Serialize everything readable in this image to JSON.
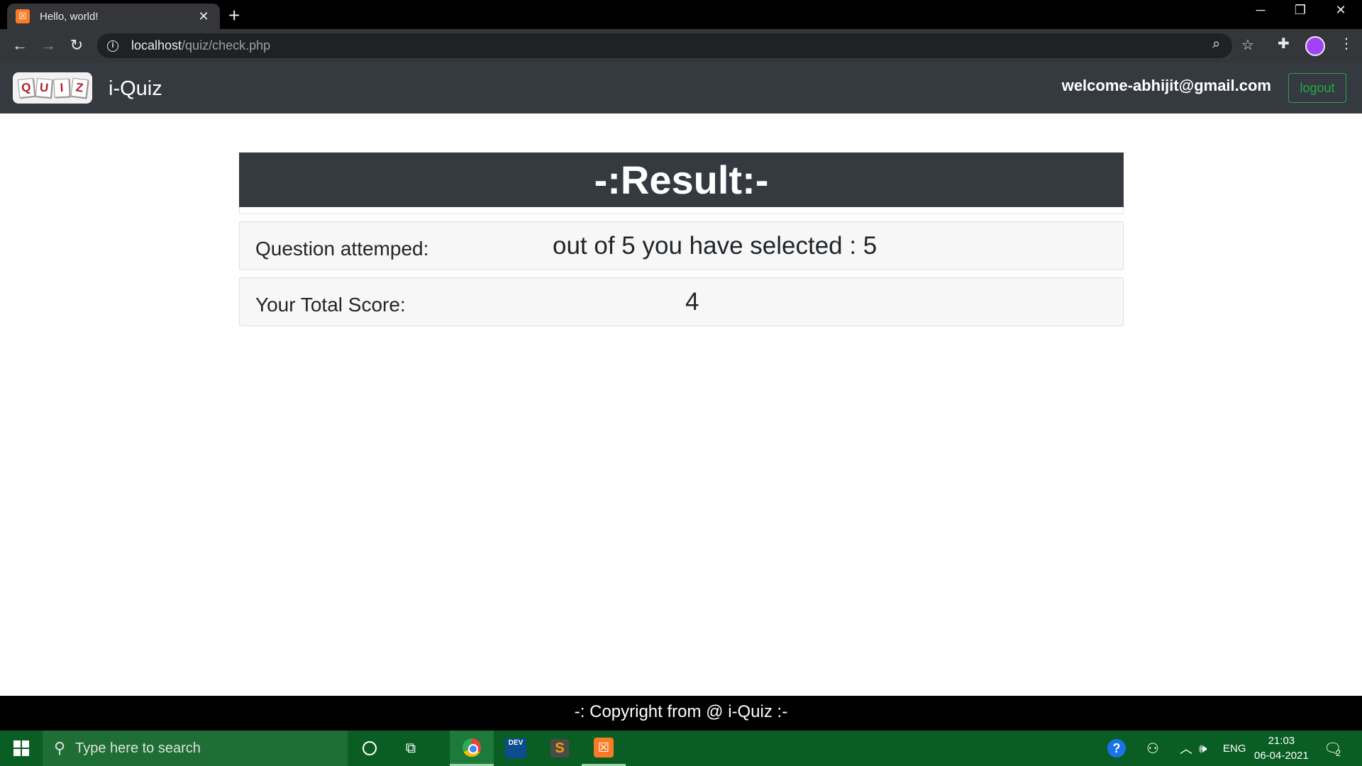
{
  "browser": {
    "tab_title": "Hello, world!",
    "favicon_icon": "xampp-icon",
    "new_tab_symbol": "+",
    "url_host": "localhost",
    "url_path": "/quiz/check.php"
  },
  "site": {
    "logo_letters": [
      "Q",
      "U",
      "I",
      "Z"
    ],
    "brand": "i-Quiz",
    "welcome_text": "welcome-abhijit@gmail.com",
    "logout_label": "logout"
  },
  "result": {
    "heading": "-:Result:-",
    "attempted_label": "Question attemped:",
    "attempted_value": "out of 5 you have selected : 5",
    "score_label": "Your Total Score:",
    "score_value": "4"
  },
  "footer": {
    "text": "-: Copyright from @ i-Quiz :-"
  },
  "taskbar": {
    "search_placeholder": "Type here to search",
    "language": "ENG",
    "time": "21:03",
    "date": "06-04-2021",
    "notification_count": "2",
    "dev_icon_text": "DEV",
    "sublime_icon_text": "S"
  },
  "colors": {
    "navbar": "#343a40",
    "logout_accent": "#28a745",
    "taskbar": "#0a5e23",
    "footer": "#000000"
  }
}
